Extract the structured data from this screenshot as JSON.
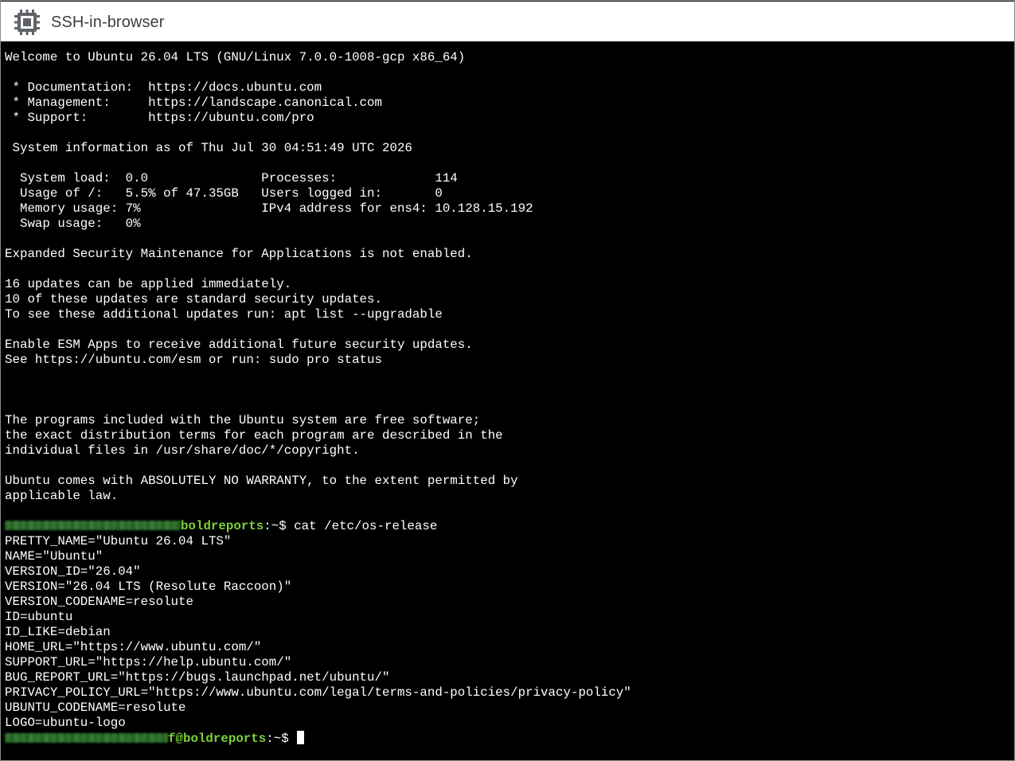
{
  "window": {
    "title": "SSH-in-browser",
    "icon": "chip-icon"
  },
  "terminal": {
    "motd_lines": [
      "Welcome to Ubuntu 26.04 LTS (GNU/Linux 7.0.0-1008-gcp x86_64)",
      "",
      " * Documentation:  https://docs.ubuntu.com",
      " * Management:     https://landscape.canonical.com",
      " * Support:        https://ubuntu.com/pro",
      "",
      " System information as of Thu Jul 30 04:51:49 UTC 2026",
      "",
      "  System load:  0.0               Processes:             114",
      "  Usage of /:   5.5% of 47.35GB   Users logged in:       0",
      "  Memory usage: 7%                IPv4 address for ens4: 10.128.15.192",
      "  Swap usage:   0%",
      "",
      "Expanded Security Maintenance for Applications is not enabled.",
      "",
      "16 updates can be applied immediately.",
      "10 of these updates are standard security updates.",
      "To see these additional updates run: apt list --upgradable",
      "",
      "Enable ESM Apps to receive additional future security updates.",
      "See https://ubuntu.com/esm or run: sudo pro status",
      "",
      "",
      "",
      "The programs included with the Ubuntu system are free software;",
      "the exact distribution terms for each program are described in the",
      "individual files in /usr/share/doc/*/copyright.",
      "",
      "Ubuntu comes with ABSOLUTELY NO WARRANTY, to the extent permitted by",
      "applicable law.",
      ""
    ],
    "prompt1": {
      "host": "boldreports",
      "path": ":~$ ",
      "command": "cat /etc/os-release"
    },
    "output_lines": [
      "PRETTY_NAME=\"Ubuntu 26.04 LTS\"",
      "NAME=\"Ubuntu\"",
      "VERSION_ID=\"26.04\"",
      "VERSION=\"26.04 LTS (Resolute Raccoon)\"",
      "VERSION_CODENAME=resolute",
      "ID=ubuntu",
      "ID_LIKE=debian",
      "HOME_URL=\"https://www.ubuntu.com/\"",
      "SUPPORT_URL=\"https://help.ubuntu.com/\"",
      "BUG_REPORT_URL=\"https://bugs.launchpad.net/ubuntu/\"",
      "PRIVACY_POLICY_URL=\"https://www.ubuntu.com/legal/terms-and-policies/privacy-policy\"",
      "UBUNTU_CODENAME=resolute",
      "LOGO=ubuntu-logo"
    ],
    "prompt2": {
      "host": "f@boldreports",
      "path": ":~$ "
    }
  },
  "colors": {
    "terminal_bg": "#000000",
    "terminal_fg": "#ffffff",
    "prompt_host": "#7bd13a",
    "titlebar_bg": "#ffffff",
    "title_text": "#3c4043"
  }
}
